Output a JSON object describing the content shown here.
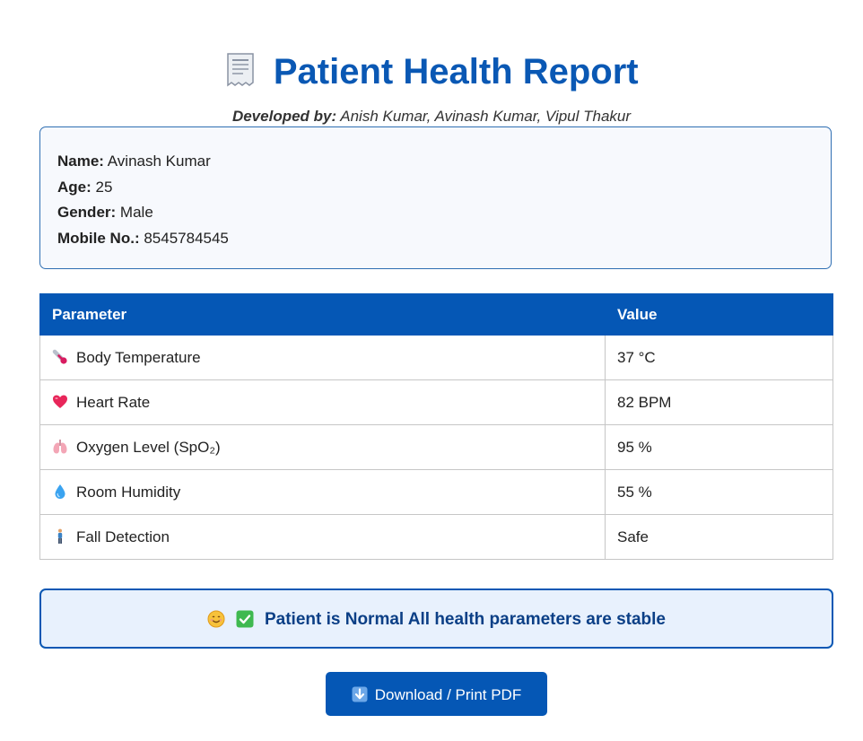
{
  "header": {
    "title": "Patient Health Report",
    "title_icon": "receipt-icon",
    "developed_by_label": "Developed by:",
    "developed_by_names": "Anish Kumar, Avinash Kumar, Vipul Thakur"
  },
  "patient": {
    "name_label": "Name:",
    "name": "Avinash Kumar",
    "age_label": "Age:",
    "age": "25",
    "gender_label": "Gender:",
    "gender": "Male",
    "mobile_label": "Mobile No.:",
    "mobile": "8545784545"
  },
  "table": {
    "headers": [
      "Parameter",
      "Value"
    ],
    "rows": [
      {
        "icon": "thermometer-icon",
        "parameter": "Body Temperature",
        "value": "37 °C"
      },
      {
        "icon": "heart-icon",
        "parameter": "Heart Rate",
        "value": "82 BPM"
      },
      {
        "icon": "lungs-icon",
        "parameter": "Oxygen Level (SpO₂)",
        "value": "95 %"
      },
      {
        "icon": "droplet-icon",
        "parameter": "Room Humidity",
        "value": "55 %"
      },
      {
        "icon": "person-standing-icon",
        "parameter": "Fall Detection",
        "value": "Safe"
      }
    ]
  },
  "status": {
    "icons": [
      "smiling-face-icon",
      "check-mark-icon"
    ],
    "text": "Patient is Normal All health parameters are stable"
  },
  "download": {
    "icon": "down-arrow-icon",
    "label": "Download / Print PDF"
  },
  "colors": {
    "primary": "#0557b5",
    "title": "#0a58b4",
    "status_bg": "#e8f1fd",
    "status_text": "#0b3f86"
  }
}
